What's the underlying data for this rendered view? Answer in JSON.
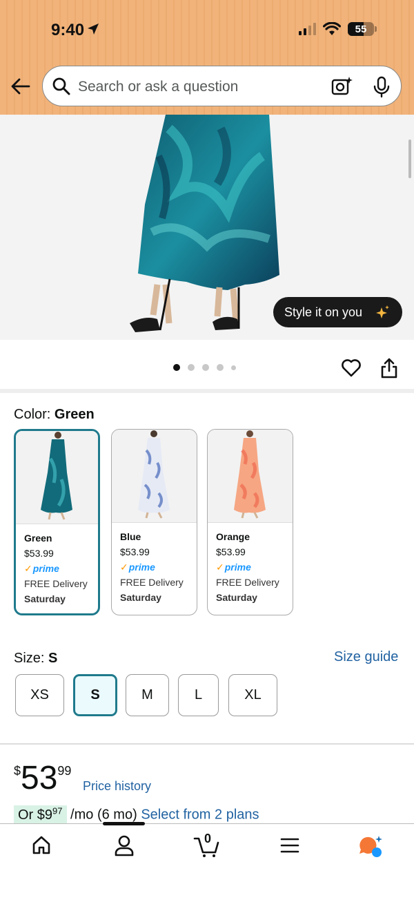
{
  "status_bar": {
    "time": "9:40",
    "battery": "55"
  },
  "search": {
    "placeholder": "Search or ask a question"
  },
  "product": {
    "style_button_label": "Style it on you",
    "image_count": 5,
    "active_image": 1
  },
  "color": {
    "label": "Color: ",
    "selected": "Green",
    "options": [
      {
        "name": "Green",
        "price": "$53.99",
        "prime": "prime",
        "delivery": "FREE Delivery",
        "day": "Saturday"
      },
      {
        "name": "Blue",
        "price": "$53.99",
        "prime": "prime",
        "delivery": "FREE Delivery",
        "day": "Saturday"
      },
      {
        "name": "Orange",
        "price": "$53.99",
        "prime": "prime",
        "delivery": "FREE Delivery",
        "day": "Saturday"
      }
    ]
  },
  "size": {
    "label": "Size: ",
    "selected": "S",
    "guide_label": "Size guide",
    "options": [
      "XS",
      "S",
      "M",
      "L",
      "XL"
    ]
  },
  "price": {
    "currency": "$",
    "whole": "53",
    "fraction": "99",
    "history_label": "Price history",
    "monthly_prefix": "Or $",
    "monthly_whole": "9",
    "monthly_fraction": "97",
    "monthly_suffix": " /mo (6 mo)",
    "plans_link": "Select from 2 plans"
  },
  "colors": {
    "accent": "#1f7a8c",
    "link": "#2162a1",
    "header_bg": "#f1b37a",
    "prime_blue": "#1a98ff"
  },
  "nav": {
    "cart_count": "0",
    "items": [
      "home-icon",
      "account-icon",
      "cart-icon",
      "menu-icon",
      "rufus-icon"
    ]
  }
}
